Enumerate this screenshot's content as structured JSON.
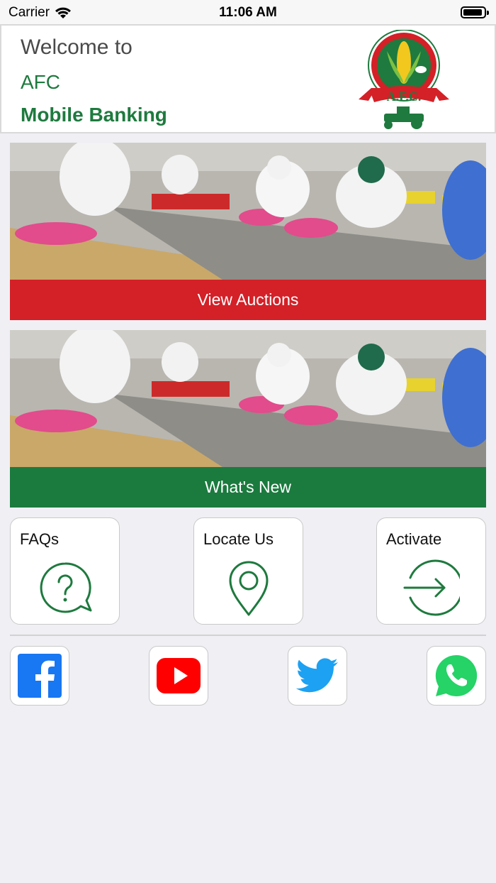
{
  "status_bar": {
    "carrier": "Carrier",
    "time": "11:06 AM"
  },
  "header": {
    "welcome": "Welcome to",
    "brand": "AFC",
    "subtitle": "Mobile Banking",
    "logo_text": "A.F.C."
  },
  "banners": [
    {
      "button_label": "View Auctions",
      "button_color": "#d42027"
    },
    {
      "button_label": "What's New",
      "button_color": "#1b7a3e"
    }
  ],
  "tiles": [
    {
      "label": "FAQs",
      "icon": "question-bubble-icon"
    },
    {
      "label": "Locate Us",
      "icon": "location-pin-icon"
    },
    {
      "label": "Activate",
      "icon": "sign-in-arrow-icon"
    }
  ],
  "social": [
    {
      "name": "Facebook",
      "icon": "facebook-icon",
      "color": "#1877f2"
    },
    {
      "name": "YouTube",
      "icon": "youtube-icon",
      "color": "#ff0000"
    },
    {
      "name": "Twitter",
      "icon": "twitter-icon",
      "color": "#1da1f2"
    },
    {
      "name": "WhatsApp",
      "icon": "whatsapp-icon",
      "color": "#25d366"
    }
  ],
  "colors": {
    "brand_green": "#1e7a3e",
    "brand_red": "#d42027",
    "background": "#efeff4"
  }
}
